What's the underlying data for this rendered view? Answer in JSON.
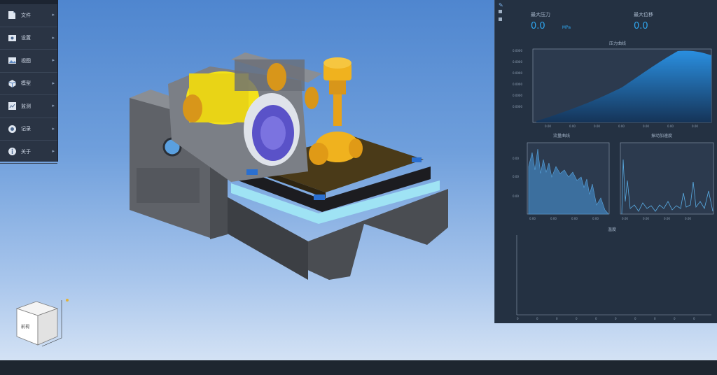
{
  "toolbar": {
    "items": [
      {
        "icon": "file-icon",
        "label": "文件"
      },
      {
        "icon": "settings-icon",
        "label": "设置"
      },
      {
        "icon": "image-icon",
        "label": "视图"
      },
      {
        "icon": "model-icon",
        "label": "模型"
      },
      {
        "icon": "monitor-icon",
        "label": "监测"
      },
      {
        "icon": "record-icon",
        "label": "记录"
      },
      {
        "icon": "info-icon",
        "label": "关于"
      }
    ]
  },
  "panel": {
    "metric_left": {
      "label": "最大压力",
      "value": "0.0",
      "unit": "MPa"
    },
    "metric_right": {
      "label": "最大位移",
      "value": "0.0"
    },
    "chart1": {
      "title": "压力曲线"
    },
    "chart2": {
      "title": "流量曲线"
    },
    "chart3": {
      "title": "振动加速度"
    },
    "chart4": {
      "title": "温度"
    }
  },
  "viewport": {
    "navcube_face": "前视",
    "colors": {
      "housing": "#6b6f76",
      "valve": "#e7a21a",
      "drum": "#f3e21a",
      "table": "#3a3020",
      "accent_ring": "#7fd3ea"
    }
  }
}
